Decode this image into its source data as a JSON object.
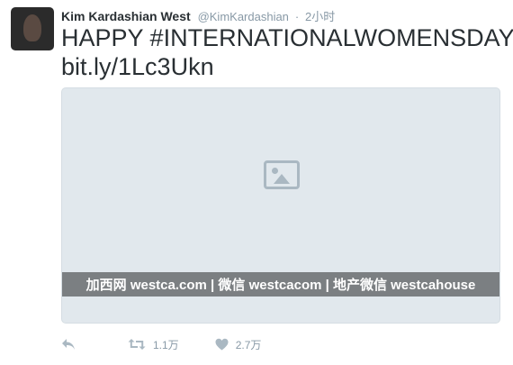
{
  "tweet": {
    "display_name": "Kim Kardashian West",
    "handle": "@KimKardashian",
    "separator": "·",
    "timestamp": "2小时",
    "text_line1": "HAPPY #INTERNATIONALWOMENSDAY",
    "link": "bit.ly/1Lc3Ukn"
  },
  "media": {
    "watermark_text": "加西网 westca.com | 微信 westcacom | 地产微信 westcahouse"
  },
  "actions": {
    "reply_icon": "reply-icon",
    "retweet_icon": "retweet-icon",
    "retweet_count": "1.1万",
    "like_icon": "heart-icon",
    "like_count": "2.7万",
    "more_icon": "more-icon"
  },
  "colors": {
    "text_primary": "#292f33",
    "text_secondary": "#8899a6",
    "icon_gray": "#aab8c2"
  }
}
